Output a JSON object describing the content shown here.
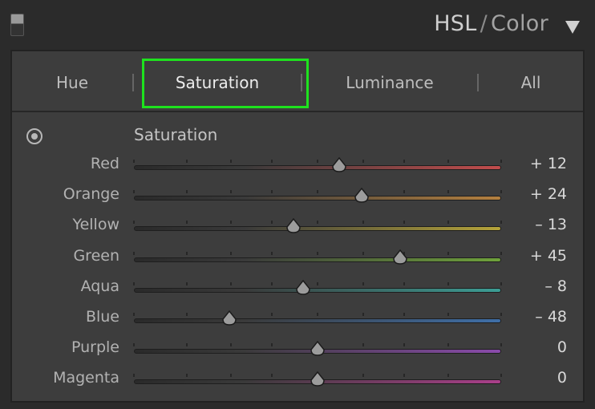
{
  "header": {
    "title": "HSL",
    "title_separator": "/",
    "title_secondary": "Color"
  },
  "tabs": [
    {
      "label": "Hue"
    },
    {
      "label": "Saturation",
      "active": true
    },
    {
      "label": "Luminance"
    },
    {
      "label": "All"
    }
  ],
  "section": {
    "label": "Saturation"
  },
  "sliders": [
    {
      "label": "Red",
      "display": "+ 12",
      "value": 12,
      "color": "#c24c4c"
    },
    {
      "label": "Orange",
      "display": "+ 24",
      "value": 24,
      "color": "#b4803f"
    },
    {
      "label": "Yellow",
      "display": "– 13",
      "value": -13,
      "color": "#b6a43a"
    },
    {
      "label": "Green",
      "display": "+ 45",
      "value": 45,
      "color": "#6fa23b"
    },
    {
      "label": "Aqua",
      "display": "– 8",
      "value": -8,
      "color": "#3c9e95"
    },
    {
      "label": "Blue",
      "display": "– 48",
      "value": -48,
      "color": "#3f6fa8"
    },
    {
      "label": "Purple",
      "display": "0",
      "value": 0,
      "color": "#8a4bab"
    },
    {
      "label": "Magenta",
      "display": "0",
      "value": 0,
      "color": "#aa3f8a"
    }
  ],
  "slider_range": [
    -100,
    100
  ],
  "accent_highlight": "#1ee21e"
}
